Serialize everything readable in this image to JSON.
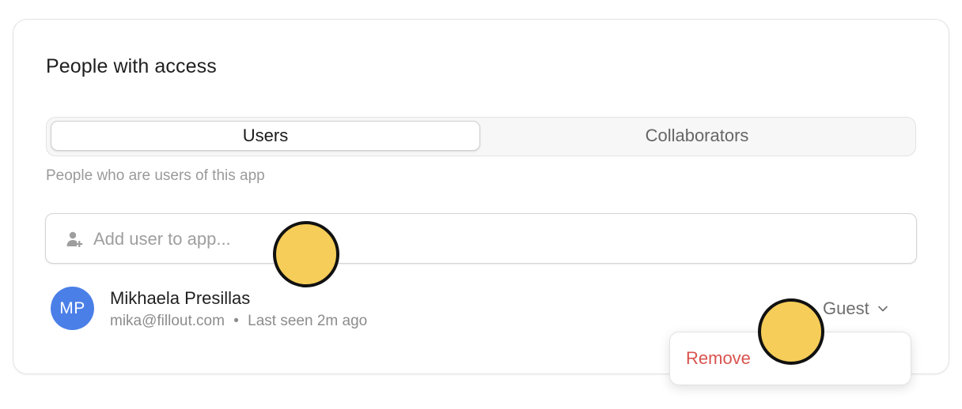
{
  "section": {
    "title": "People with access",
    "subtitle": "People who are users of this app"
  },
  "tabs": [
    {
      "label": "Users",
      "selected": true
    },
    {
      "label": "Collaborators",
      "selected": false
    }
  ],
  "search": {
    "placeholder": "Add user to app...",
    "value": "",
    "icon": "add-user-icon"
  },
  "user": {
    "initials": "MP",
    "name": "Mikhaela Presillas",
    "email": "mika@fillout.com",
    "separator": "•",
    "last_seen": "Last seen 2m ago",
    "role": "Guest",
    "avatar_color": "#4a7fe8"
  },
  "menu": {
    "remove_label": "Remove",
    "remove_color": "#d9534f"
  },
  "markers": {
    "color": "#f5cd58"
  }
}
